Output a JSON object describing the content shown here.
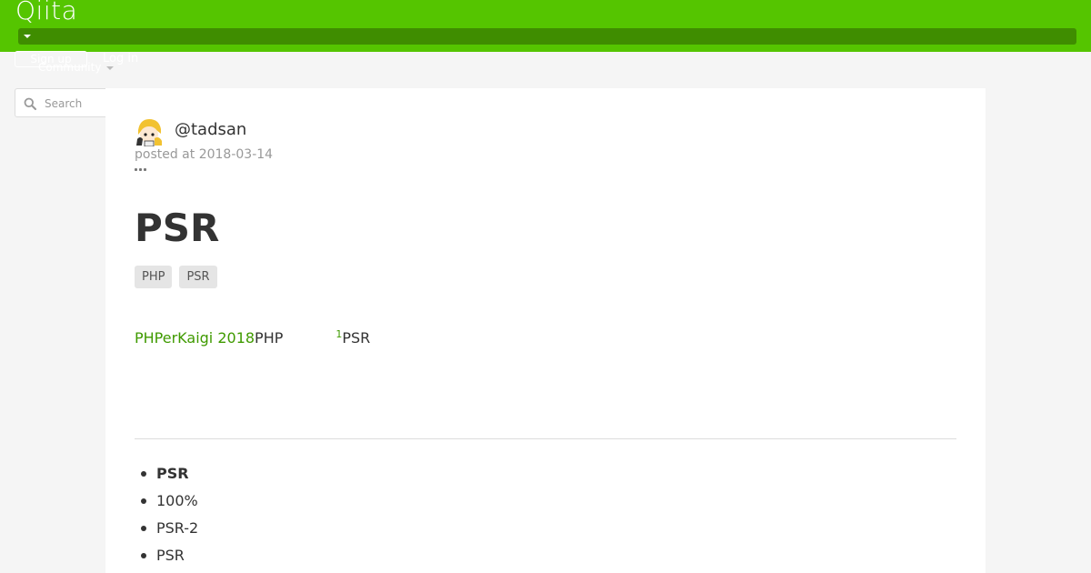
{
  "header": {
    "logo": "Qiita",
    "brand_color": "#55c500",
    "menu_bar_color": "#3f8d00"
  },
  "auth": {
    "signup_label": "Sign up",
    "login_label": "Log in"
  },
  "nav": {
    "community_label": "Community"
  },
  "search": {
    "placeholder": "Search",
    "icon": "search-icon"
  },
  "article": {
    "author": "@tadsan",
    "posted": "posted at 2018-03-14",
    "title": "PSR",
    "tags": [
      "PHP",
      "PSR"
    ],
    "intro": {
      "link_text": "PHPerKaigi 2018",
      "text_after_link": "PHP",
      "footnote_ref": "1",
      "text_after_footnote": "PSR"
    },
    "list_items": [
      {
        "text": "PSR",
        "bold": true
      },
      {
        "text": "100%",
        "bold": false
      },
      {
        "text": "PSR-2",
        "bold": false
      },
      {
        "text": "PSR",
        "bold": false
      }
    ]
  }
}
